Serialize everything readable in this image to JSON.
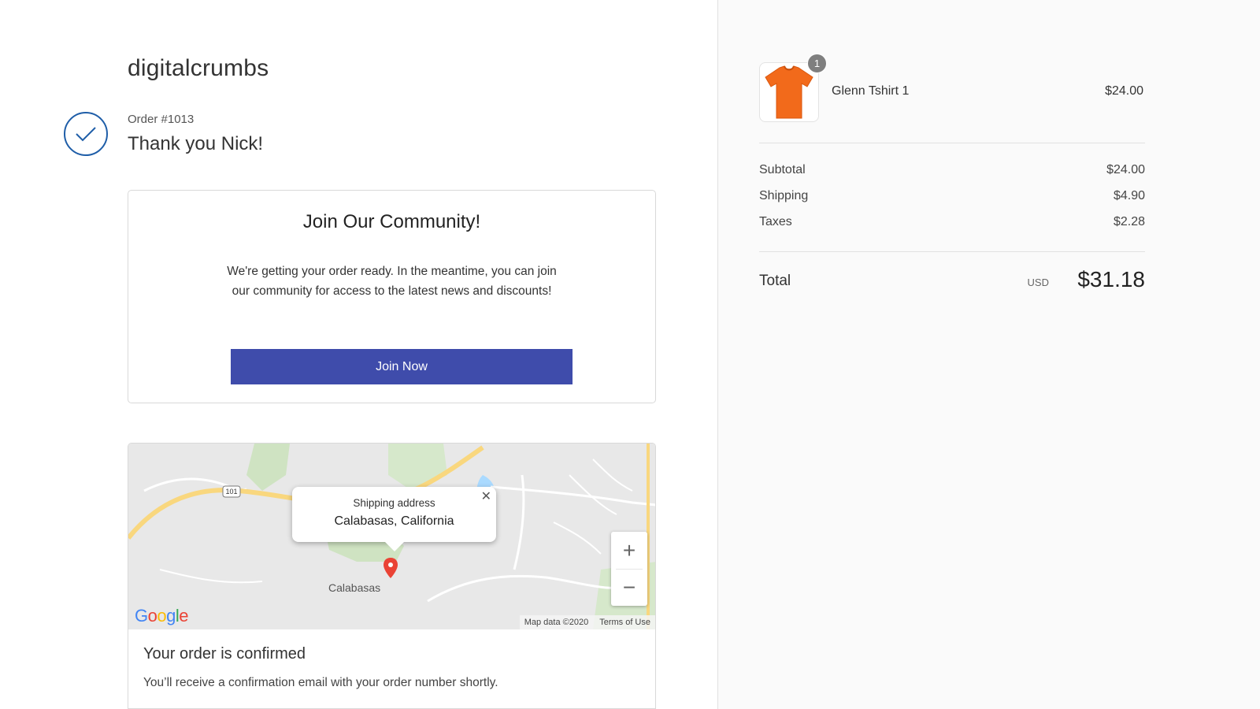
{
  "store": {
    "name": "digitalcrumbs"
  },
  "order": {
    "number_label": "Order #1013",
    "thank_you": "Thank you Nick!"
  },
  "community": {
    "title": "Join Our Community!",
    "body": "We're getting your order ready. In the meantime, you can join our community for access to the latest news and discounts!",
    "button_label": "Join Now",
    "button_color": "#3f4cab"
  },
  "map": {
    "popup_title": "Shipping address",
    "popup_city": "Calabasas, California",
    "city_label": "Calabasas",
    "highway_label": "101",
    "zoom_in": "+",
    "zoom_out": "−",
    "google_logo": "Google",
    "map_data": "Map data ©2020",
    "terms": "Terms of Use",
    "close_icon": "close-icon",
    "pin_color": "#ea4335"
  },
  "confirmation": {
    "title": "Your order is confirmed",
    "message": "You’ll receive a confirmation email with your order number shortly."
  },
  "cart": {
    "items": [
      {
        "name": "Glenn Tshirt 1",
        "price": "$24.00",
        "quantity": "1",
        "image": "orange-tshirt",
        "image_color": "#f26a1b"
      }
    ],
    "summary": [
      {
        "label": "Subtotal",
        "value": "$24.00"
      },
      {
        "label": "Shipping",
        "value": "$4.90"
      },
      {
        "label": "Taxes",
        "value": "$2.28"
      }
    ],
    "total_label": "Total",
    "currency": "USD",
    "total_value": "$31.18"
  },
  "colors": {
    "accent": "#1f5ea8",
    "aside_bg": "#fafafa"
  }
}
